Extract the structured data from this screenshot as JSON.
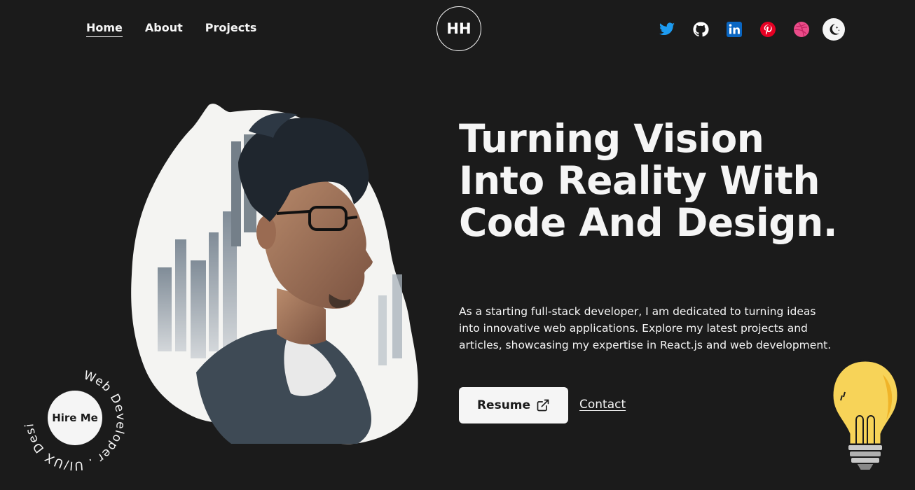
{
  "nav": {
    "links": [
      {
        "label": "Home",
        "active": true
      },
      {
        "label": "About",
        "active": false
      },
      {
        "label": "Projects",
        "active": false
      }
    ],
    "logo": "HH"
  },
  "socials": [
    {
      "icon": "twitter-icon",
      "color": "#1d9bf0"
    },
    {
      "icon": "github-icon",
      "color": "#ffffff"
    },
    {
      "icon": "linkedin-icon",
      "color": "#0a66c2"
    },
    {
      "icon": "pinterest-icon",
      "color": "#e60023"
    },
    {
      "icon": "dribbble-icon",
      "color": "#ea4c89"
    },
    {
      "icon": "moon-icon",
      "color": "#1b1b1b"
    }
  ],
  "hero": {
    "headline": "Turning Vision Into Reality With Code And Design.",
    "intro": "As a starting full-stack developer, I am dedicated to turning ideas into innovative web applications. Explore my latest projects and articles, showcasing my expertise in React.js and web development.",
    "resume_label": "Resume",
    "contact_label": "Contact"
  },
  "badge": {
    "circle_text": "Web Developer . UI/UX Designer .",
    "button_label": "Hire Me"
  },
  "colors": {
    "background": "#1b1b1b",
    "foreground": "#f5f5f5"
  }
}
